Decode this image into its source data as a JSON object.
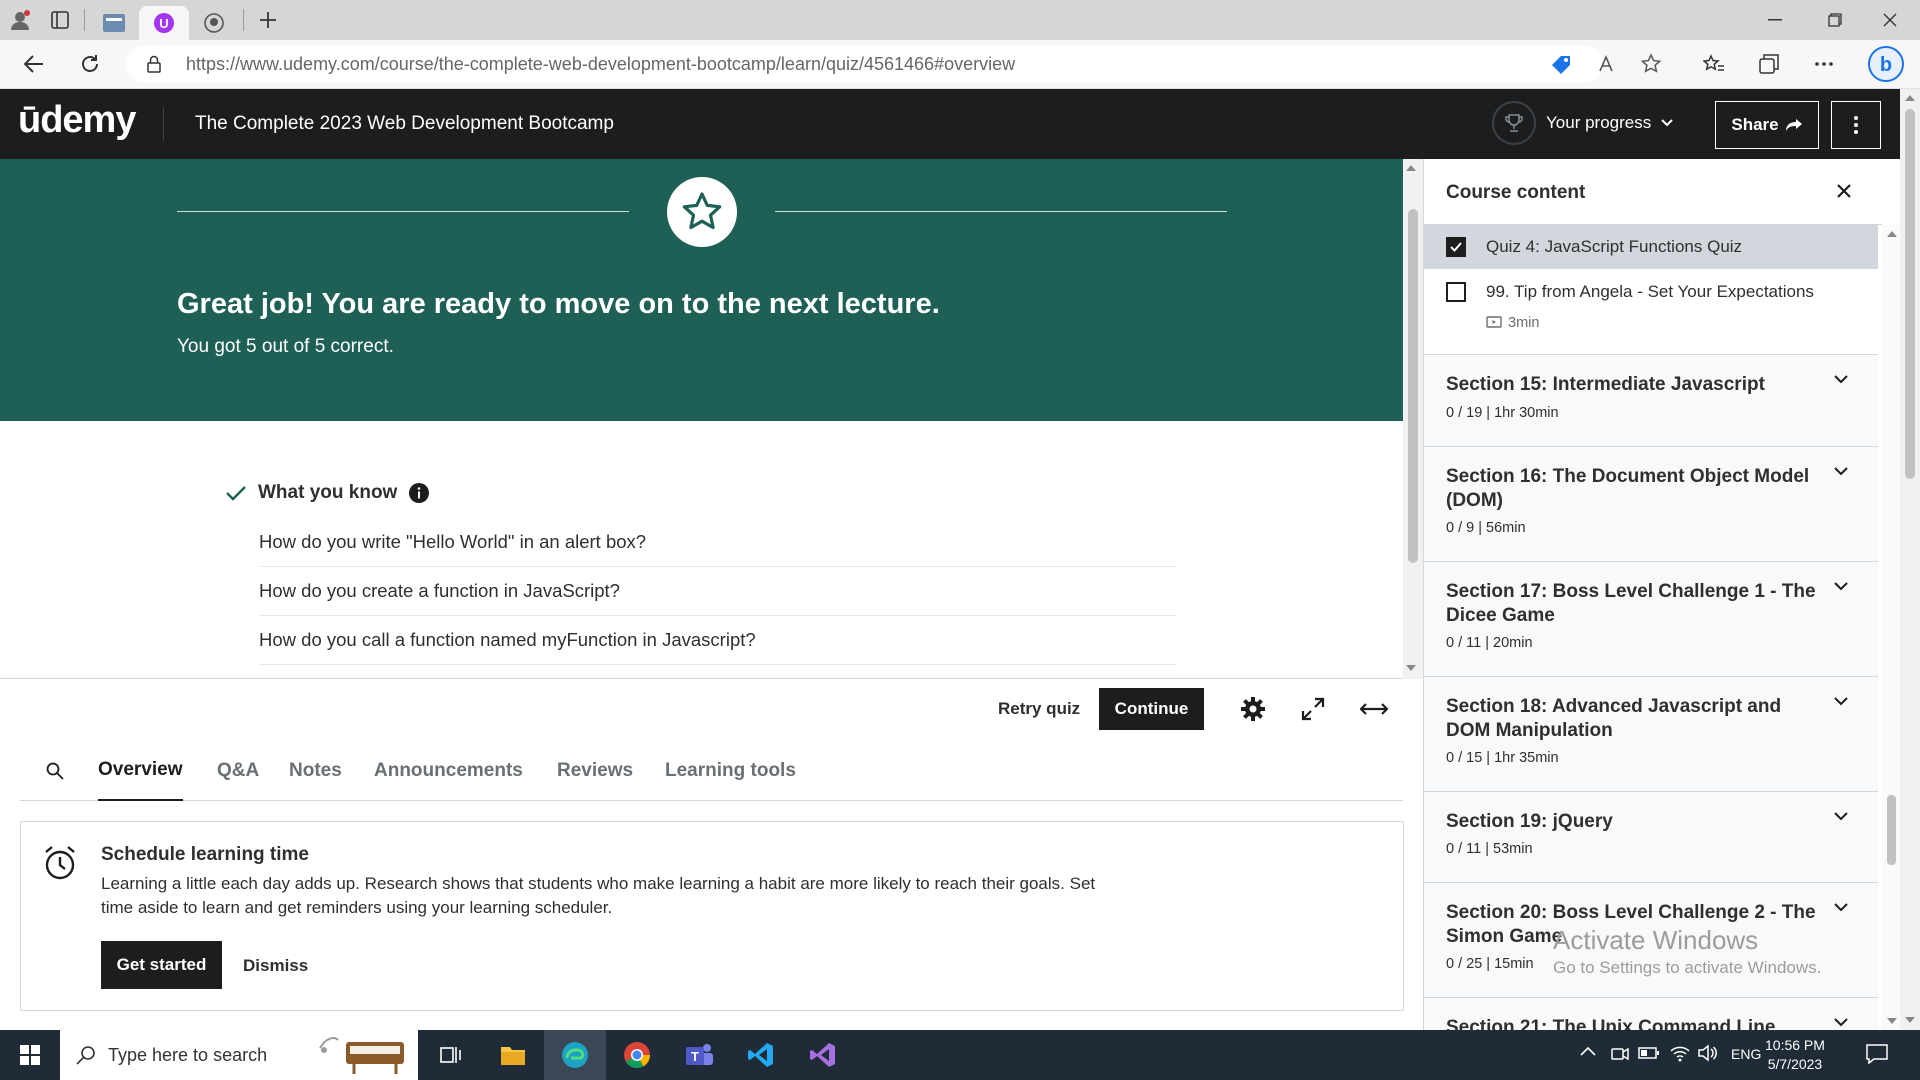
{
  "browser": {
    "url": "https://www.udemy.com/course/the-complete-web-development-bootcamp/learn/quiz/4561466#overview",
    "tabs": [
      {
        "icon": "page-icon"
      },
      {
        "icon": "udemy-icon"
      },
      {
        "icon": "github-icon"
      }
    ]
  },
  "header": {
    "logo": "ūdemy",
    "course_title": "The Complete 2023 Web Development Bootcamp",
    "progress_label": "Your progress",
    "share_label": "Share"
  },
  "banner": {
    "heading": "Great job! You are ready to move on to the next lecture.",
    "score": "You got 5 out of 5 correct."
  },
  "what_you_know": {
    "title": "What you know",
    "questions": [
      "How do you write \"Hello World\" in an alert box?",
      "How do you create a function in JavaScript?",
      "How do you call a function named myFunction in Javascript?"
    ]
  },
  "quiz_footer": {
    "retry_label": "Retry quiz",
    "continue_label": "Continue"
  },
  "content_tabs": [
    "Overview",
    "Q&A",
    "Notes",
    "Announcements",
    "Reviews",
    "Learning tools"
  ],
  "schedule": {
    "title": "Schedule learning time",
    "text": "Learning a little each day adds up. Research shows that students who make learning a habit are more likely to reach their goals. Set time aside to learn and get reminders using your learning scheduler.",
    "get_started_label": "Get started",
    "dismiss_label": "Dismiss"
  },
  "sidebar": {
    "title": "Course content",
    "items": [
      {
        "label": "Quiz 4: JavaScript Functions Quiz",
        "checked": true
      },
      {
        "label": "99. Tip from Angela - Set Your Expectations",
        "checked": false,
        "duration": "3min"
      }
    ],
    "sections": [
      {
        "title": "Section 15: Intermediate Javascript",
        "meta": "0 / 19 | 1hr 30min"
      },
      {
        "title": "Section 16: The Document Object Model (DOM)",
        "meta": "0 / 9 | 56min"
      },
      {
        "title": "Section 17: Boss Level Challenge 1 - The Dicee Game",
        "meta": "0 / 11 | 20min"
      },
      {
        "title": "Section 18: Advanced Javascript and DOM Manipulation",
        "meta": "0 / 15 | 1hr 35min"
      },
      {
        "title": "Section 19: jQuery",
        "meta": "0 / 11 | 53min"
      },
      {
        "title": "Section 20: Boss Level Challenge 2 - The Simon Game",
        "meta": "0 / 25 | 15min"
      },
      {
        "title": "Section 21: The Unix Command Line",
        "meta": ""
      }
    ]
  },
  "watermark": {
    "line1": "Activate Windows",
    "line2": "Go to Settings to activate Windows."
  },
  "taskbar": {
    "search_placeholder": "Type here to search",
    "language": "ENG",
    "time": "10:56 PM",
    "date": "5/7/2023"
  },
  "colors": {
    "banner": "#1e6055",
    "header": "#1c1d1f",
    "taskbar": "#1f2b36"
  }
}
